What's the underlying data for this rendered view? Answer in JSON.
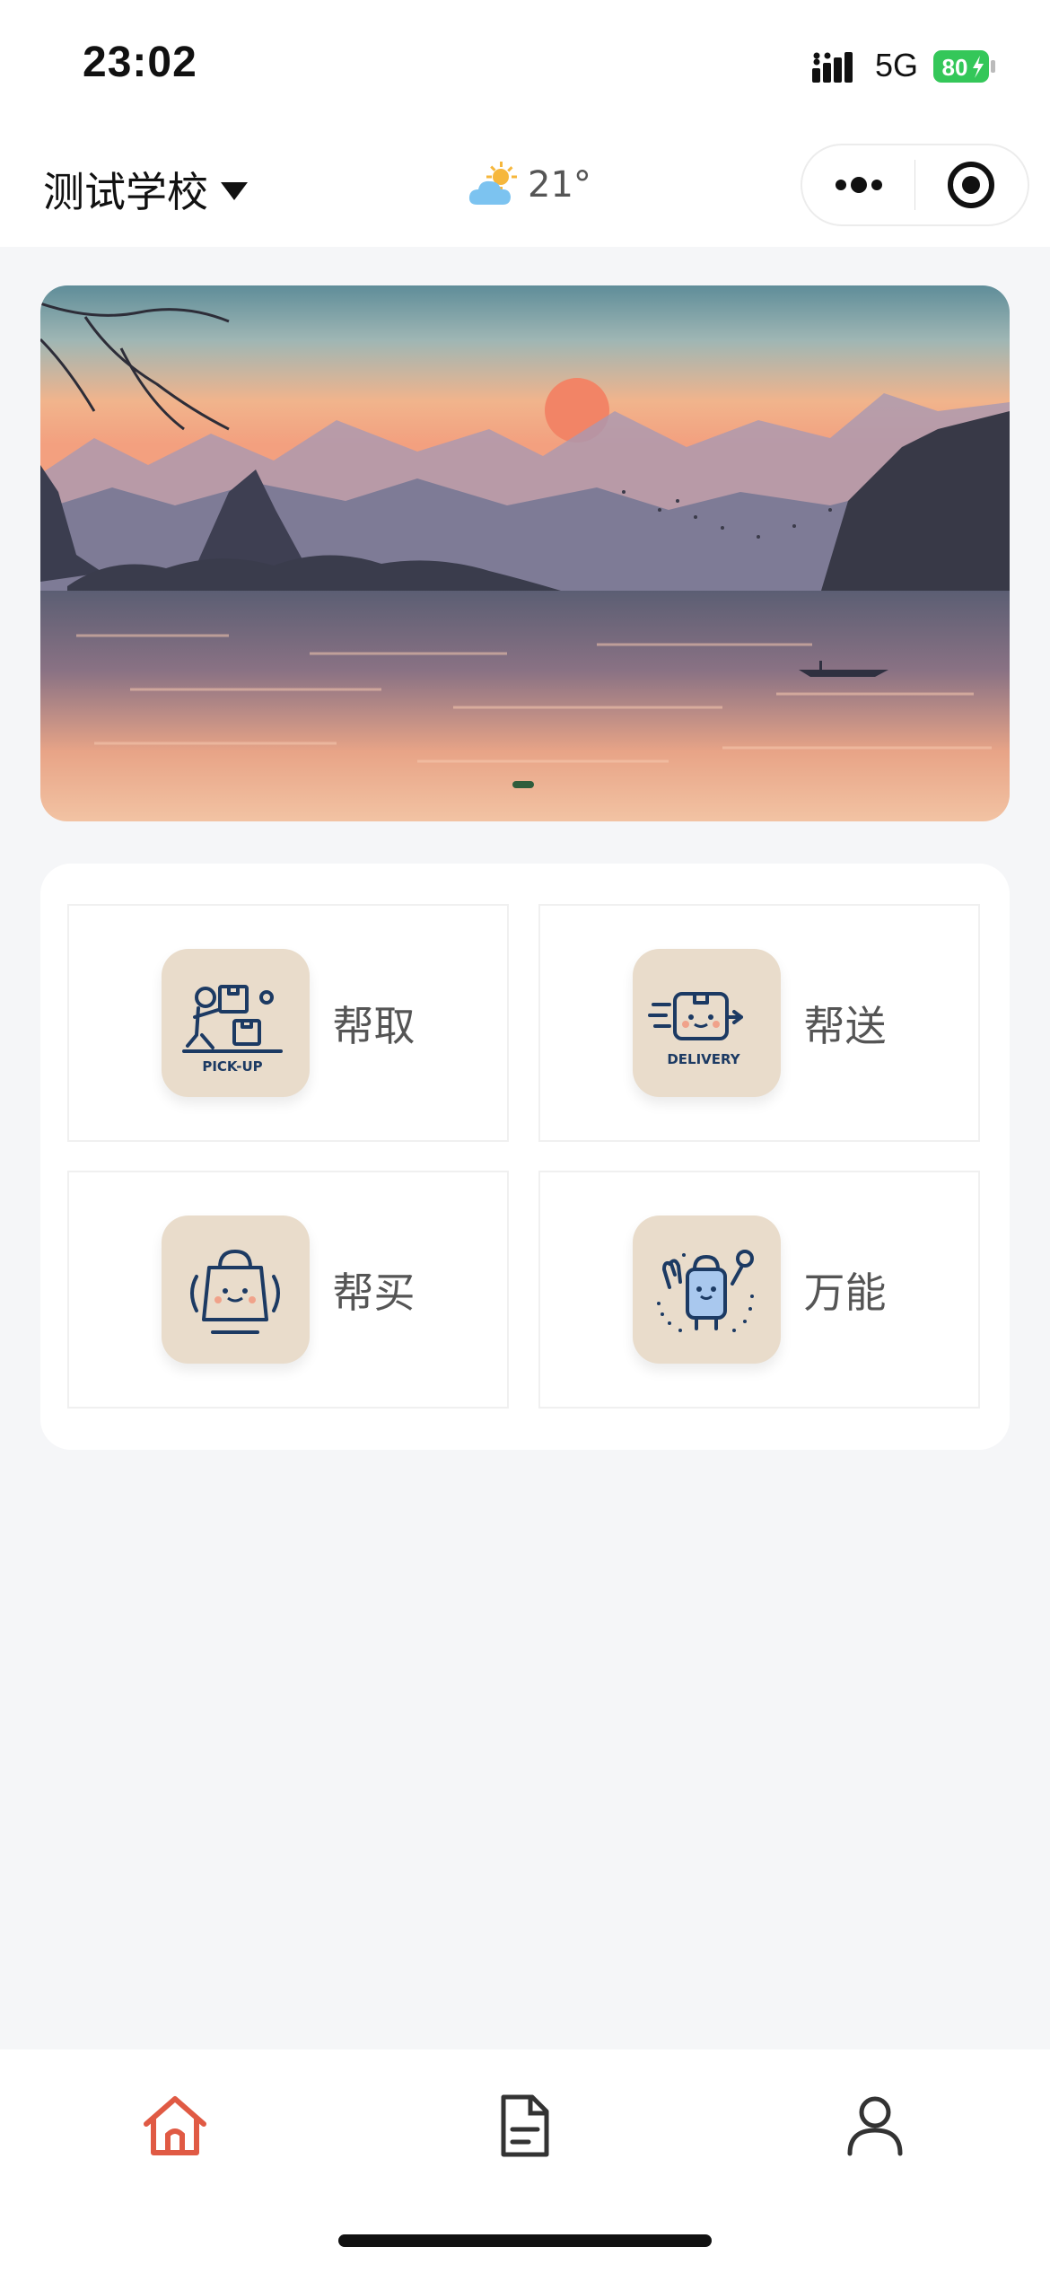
{
  "status_bar": {
    "time": "23:02",
    "network": "5G",
    "battery": "80"
  },
  "nav": {
    "school": "测试学校",
    "weather_temp": "21°",
    "weather_icon": "partly-cloudy-icon",
    "capsule_icons": [
      "more-icon",
      "target-icon"
    ]
  },
  "banner": {
    "slides": 1,
    "active_index": 0
  },
  "services": [
    {
      "label": "帮取",
      "badge": "PICK-UP",
      "icon": "pickup-icon"
    },
    {
      "label": "帮送",
      "badge": "DELIVERY",
      "icon": "delivery-icon"
    },
    {
      "label": "帮买",
      "icon": "shopping-bag-icon"
    },
    {
      "label": "万能",
      "icon": "universal-icon"
    }
  ],
  "tabbar": {
    "items": [
      "home-icon",
      "orders-icon",
      "profile-icon"
    ],
    "active": 0,
    "active_color": "#e05a44"
  },
  "colors": {
    "accent": "#e05a44",
    "battery": "#34c759",
    "icon_bg": "#e9dccb"
  }
}
